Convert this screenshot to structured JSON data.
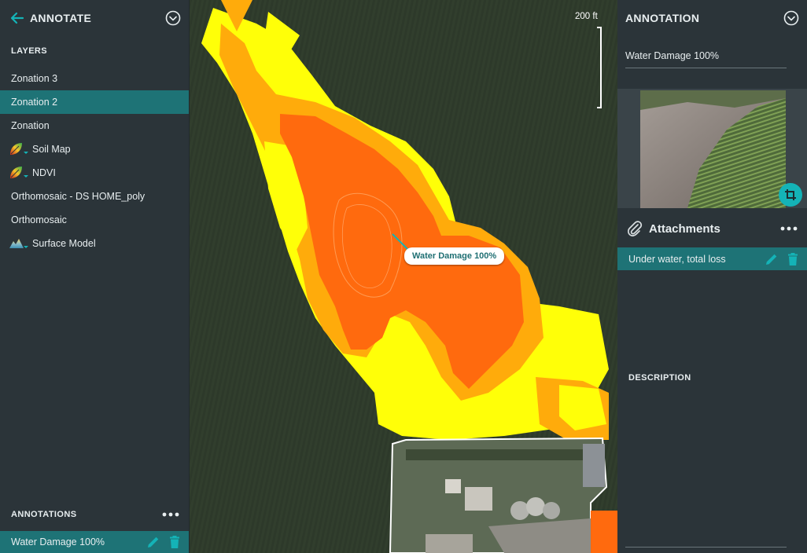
{
  "left_panel": {
    "title": "ANNOTATE",
    "layers_label": "LAYERS",
    "layers": [
      {
        "label": "Zonation 3",
        "icon": "",
        "active": false
      },
      {
        "label": "Zonation 2",
        "icon": "",
        "active": true
      },
      {
        "label": "Zonation",
        "icon": "",
        "active": false
      },
      {
        "label": "Soil Map",
        "icon": "leaf-gradient-icon",
        "active": false
      },
      {
        "label": "NDVI",
        "icon": "leaf-gradient-icon",
        "active": false
      },
      {
        "label": "Orthomosaic - DS HOME_poly",
        "icon": "",
        "active": false
      },
      {
        "label": "Orthomosaic",
        "icon": "",
        "active": false
      },
      {
        "label": "Surface Model",
        "icon": "terrain-icon",
        "active": false
      }
    ],
    "annotations_label": "ANNOTATIONS",
    "annotations": [
      {
        "label": "Water Damage 100%"
      }
    ]
  },
  "map": {
    "scale_label": "200 ft",
    "annotation_label": "Water Damage 100%"
  },
  "right_panel": {
    "title": "ANNOTATION",
    "name_value": "Water Damage 100%",
    "attachments_title": "Attachments",
    "attachments": [
      {
        "label": "Under water, total loss"
      }
    ],
    "description_label": "DESCRIPTION"
  },
  "colors": {
    "accent": "#1e7376",
    "accent_bright": "#14b3b7",
    "panel_bg": "#2b3439",
    "zone_high": "#ff6a0e",
    "zone_mid": "#ffab0b",
    "zone_low": "#ffff08"
  }
}
